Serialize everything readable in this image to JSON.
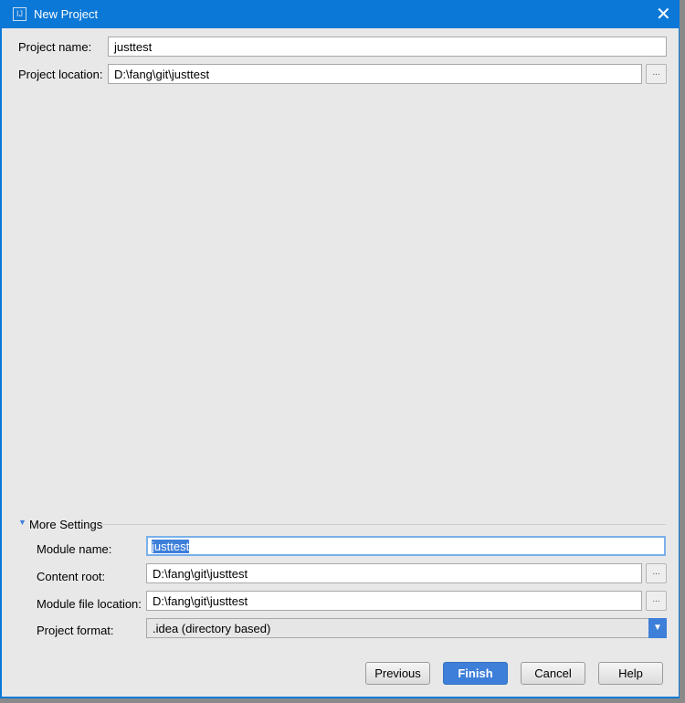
{
  "window": {
    "title": "New Project"
  },
  "fields": {
    "project_name_label": "Project name:",
    "project_name": "justtest",
    "project_location_label": "Project location:",
    "project_location": "D:\\fang\\git\\justtest",
    "browse": "..."
  },
  "more_settings": {
    "title": "More Settings",
    "module_name_label": "Module name:",
    "module_name": "justtest",
    "content_root_label": "Content root:",
    "content_root": "D:\\fang\\git\\justtest",
    "module_file_label": "Module file location:",
    "module_file": "D:\\fang\\git\\justtest",
    "format_label": "Project format:",
    "format": ".idea (directory based)"
  },
  "buttons": {
    "previous": "Previous",
    "finish": "Finish",
    "cancel": "Cancel",
    "help": "Help"
  }
}
